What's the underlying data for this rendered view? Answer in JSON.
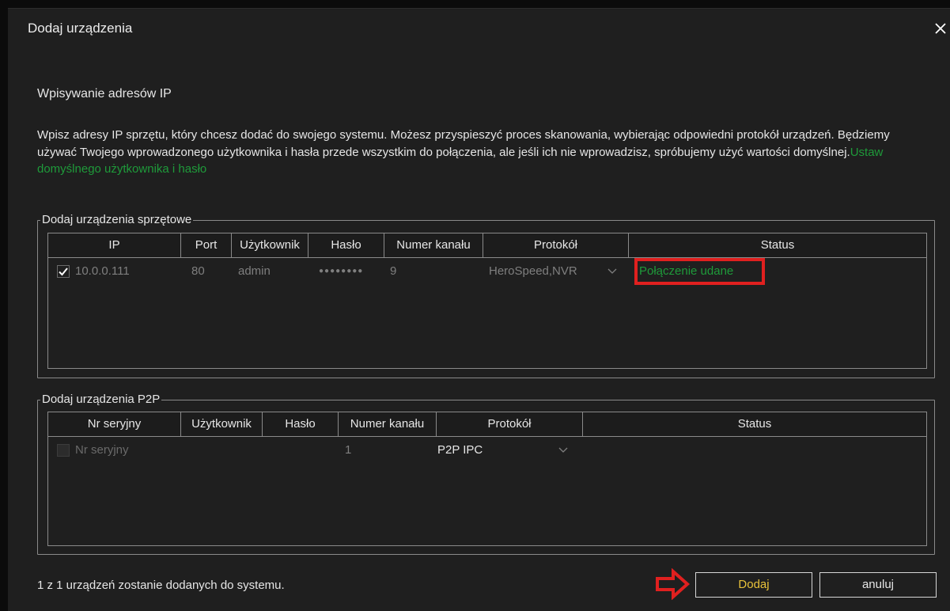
{
  "window": {
    "title": "Dodaj urządzenia"
  },
  "section_heading": "Wpisywanie adresów IP",
  "description": {
    "text": "Wpisz adresy IP sprzętu, który chcesz dodać do swojego systemu. Możesz przyspieszyć proces skanowania, wybierając odpowiedni protokół urządzeń. Będziemy używać Twojego wprowadzonego użytkownika i hasła przede wszystkim do połączenia, ale jeśli ich nie wprowadzisz, spróbujemy użyć wartości domyślnej.",
    "link": "Ustaw domyślnego użytkownika i hasło"
  },
  "hardware_group": {
    "legend": "Dodaj urządzenia sprzętowe",
    "columns": [
      "IP",
      "Port",
      "Użytkownik",
      "Hasło",
      "Numer kanału",
      "Protokół",
      "Status"
    ],
    "rows": [
      {
        "checked": true,
        "ip": "10.0.0.111",
        "port": "80",
        "user": "admin",
        "password": "●●●●●●●●",
        "channels": "9",
        "protocol": "HeroSpeed,NVR",
        "status": "Połączenie udane"
      }
    ]
  },
  "p2p_group": {
    "legend": "Dodaj urządzenia P2P",
    "columns": [
      "Nr seryjny",
      "Użytkownik",
      "Hasło",
      "Numer kanału",
      "Protokół",
      "Status"
    ],
    "rows": [
      {
        "checked": false,
        "serial_placeholder": "Nr seryjny",
        "user": "",
        "password": "",
        "channels": "1",
        "protocol": "P2P IPC",
        "status": ""
      }
    ]
  },
  "footer": {
    "summary": "1 z 1 urządzeń zostanie dodanych do systemu.",
    "add_label": "Dodaj",
    "cancel_label": "anuluj"
  },
  "colors": {
    "background": "#1f1f1f",
    "status_success": "#1f9a3a",
    "link": "#1f9a3a",
    "primary_button_text": "#e8c23a",
    "annotation_red": "#e0201f"
  }
}
